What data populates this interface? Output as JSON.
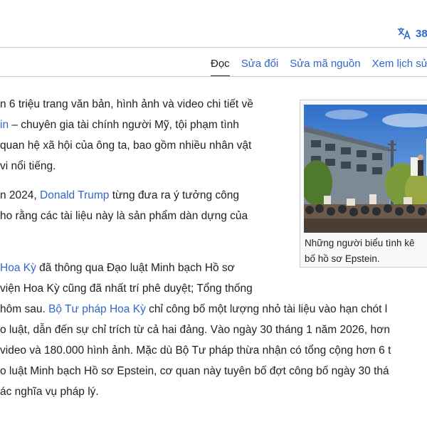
{
  "header": {
    "language_count": "38"
  },
  "tabs": [
    {
      "label": "Đọc",
      "active": true
    },
    {
      "label": "Sửa đổi",
      "active": false
    },
    {
      "label": "Sửa mã nguồn",
      "active": false
    },
    {
      "label": "Xem lịch sử",
      "active": false
    }
  ],
  "article": {
    "p1": {
      "l1": "n 6 triệu trang văn bản, hình ảnh và video chi tiết về",
      "l2_link": "in",
      "l2_text": " – chuyên gia tài chính người Mỹ, tội phạm tình",
      "l3": " quan hệ xã hội của ông ta, bao gồm nhiều nhân vật",
      "l4": "vi nổi tiếng."
    },
    "p2": {
      "l1_pre": "n 2024, ",
      "l1_link": "Donald Trump",
      "l1_post": " từng đưa ra ý tưởng công",
      "l2": "ho rằng các tài liệu này là sản phẩm dàn dựng của"
    },
    "p3": {
      "l1_link": "Hoa Kỳ",
      "l1_post": " đã thông qua Đạo luật Minh bạch Hồ sơ",
      "l2": " viện Hoa Kỳ cũng đã nhất trí phê duyệt; Tổng thống",
      "l3_pre": "hôm sau. ",
      "l3_link": "Bộ Tư pháp Hoa Kỳ",
      "l3_post": " chỉ công bố một lượng nhỏ tài liệu vào hạn chót l",
      "l4": "o luật, dẫn đến sự chỉ trích từ cả hai đảng. Vào ngày 30 tháng 1 năm 2026, hơn",
      "l5": "video và 180.000 hình ảnh. Mặc dù Bộ Tư pháp thừa nhận có tổng cộng hơn 6 t",
      "l6": "o luật Minh bạch Hồ sơ Epstein, cơ quan này tuyên bố đợt công bố ngày 30 thá",
      "l7": "ác nghĩa vụ pháp lý."
    }
  },
  "figure": {
    "caption_l1": "Những người biểu tình kê",
    "caption_l2": "bố hồ sơ Epstein."
  }
}
